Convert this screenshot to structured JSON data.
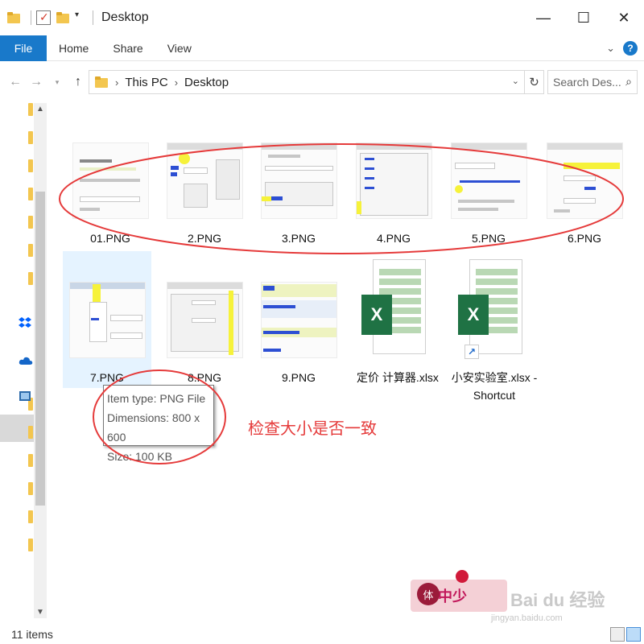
{
  "window": {
    "title": "Desktop",
    "controls": {
      "minimize": "—",
      "maximize": "☐",
      "close": "✕"
    }
  },
  "ribbon": {
    "tabs": [
      {
        "label": "File",
        "active": true
      },
      {
        "label": "Home"
      },
      {
        "label": "Share"
      },
      {
        "label": "View"
      }
    ],
    "help": "?",
    "expand": "⌄",
    "accent_color": "#1979ca"
  },
  "address": {
    "breadcrumb": [
      "This PC",
      "Desktop"
    ],
    "separator": "›",
    "search_placeholder": "Search Des...",
    "search_icon": "search-icon"
  },
  "items": [
    {
      "name": "01.PNG",
      "type": "png"
    },
    {
      "name": "2.PNG",
      "type": "png"
    },
    {
      "name": "3.PNG",
      "type": "png"
    },
    {
      "name": "4.PNG",
      "type": "png"
    },
    {
      "name": "5.PNG",
      "type": "png"
    },
    {
      "name": "6.PNG",
      "type": "png"
    },
    {
      "name": "7.PNG",
      "type": "png",
      "selected": true
    },
    {
      "name": "8.PNG",
      "type": "png"
    },
    {
      "name": "9.PNG",
      "type": "png"
    },
    {
      "name": "定价 计算器.xlsx",
      "type": "xlsx"
    },
    {
      "name": "小安实验室.xlsx - Shortcut",
      "type": "xlsx-shortcut"
    }
  ],
  "tooltip": {
    "item_type": "Item type: PNG File",
    "dimensions": "Dimensions: 800 x 600",
    "size": "Size: 100 KB"
  },
  "annotation": {
    "text": "检查大小是否一致",
    "color": "#e53a3a"
  },
  "status": {
    "item_count": "11 items"
  },
  "watermark": {
    "badge": "中少",
    "seal": "体",
    "brand": "Bai du 经验",
    "url": "jingyan.baidu.com"
  }
}
